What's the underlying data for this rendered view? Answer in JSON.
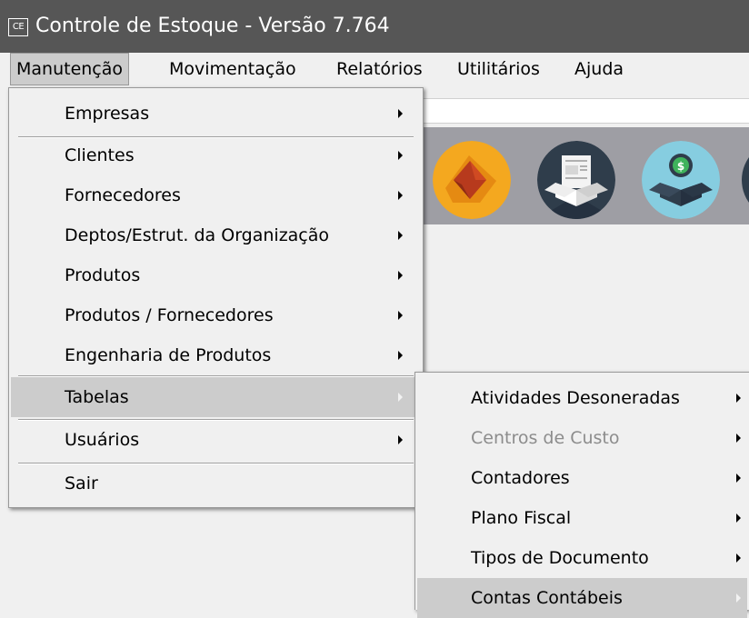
{
  "window": {
    "icon_text": "CE",
    "title": "Controle de Estoque - Versão 7.764"
  },
  "menubar": {
    "items": [
      "Manutenção",
      "Movimentação",
      "Relatórios",
      "Utilitários",
      "Ajuda"
    ]
  },
  "main_menu": {
    "items": [
      {
        "label": "Empresas"
      },
      {
        "label": "Clientes"
      },
      {
        "label": "Fornecedores"
      },
      {
        "label": "Deptos/Estrut. da Organização"
      },
      {
        "label": "Produtos"
      },
      {
        "label": "Produtos / Fornecedores"
      },
      {
        "label": "Engenharia de Produtos"
      },
      {
        "label": "Tabelas"
      },
      {
        "label": "Usuários"
      },
      {
        "label": "Sair"
      }
    ]
  },
  "submenu": {
    "items": [
      {
        "label": "Atividades Desoneradas"
      },
      {
        "label": "Centros de Custo"
      },
      {
        "label": "Contadores"
      },
      {
        "label": "Plano Fiscal"
      },
      {
        "label": "Tipos de Documento"
      },
      {
        "label": "Contas Contábeis"
      }
    ]
  },
  "toolbar": {
    "icons": [
      "shortcut-icon",
      "document-box-icon",
      "money-box-icon"
    ]
  },
  "colors": {
    "titlebar": "#565656",
    "toolbar_band": "#9e9ea4",
    "highlight": "#cccccc",
    "icon_orange": "#f4a81f",
    "icon_dark": "#2f3d4b",
    "icon_teal": "#86cde0"
  }
}
